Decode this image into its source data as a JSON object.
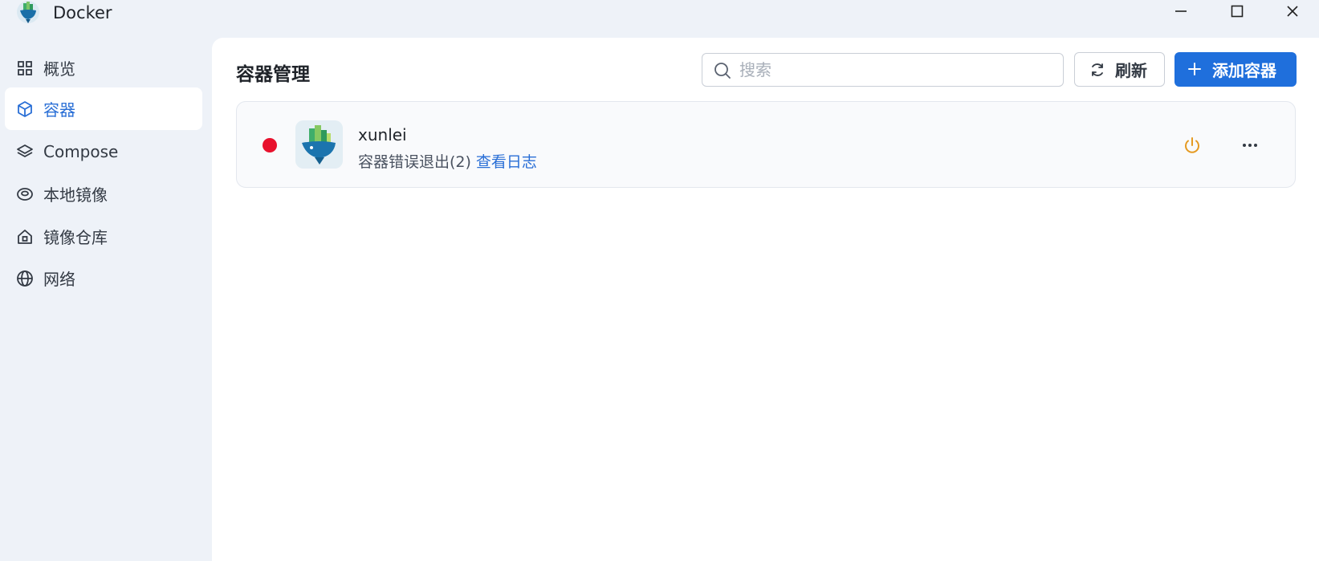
{
  "window": {
    "title": "Docker",
    "icons": [
      "docker-whale-logo",
      "minimize-icon",
      "maximize-icon",
      "close-icon"
    ]
  },
  "sidebar": {
    "items": [
      {
        "label": "概览",
        "icon": "grid-icon",
        "active": false
      },
      {
        "label": "容器",
        "icon": "cube-icon",
        "active": true
      },
      {
        "label": "Compose",
        "icon": "layers-icon",
        "active": false
      },
      {
        "label": "本地镜像",
        "icon": "eye-disc-icon",
        "active": false
      },
      {
        "label": "镜像仓库",
        "icon": "home-icon",
        "active": false
      },
      {
        "label": "网络",
        "icon": "globe-icon",
        "active": false
      }
    ],
    "active_color": "#2a6fd6"
  },
  "main": {
    "title": "容器管理",
    "search": {
      "placeholder": "搜索",
      "value": ""
    },
    "refresh_label": "刷新",
    "add_label": "添加容器",
    "accent_color": "#1f6fdc"
  },
  "containers": [
    {
      "name": "xunlei",
      "status_text": "容器错误退出(2)",
      "logs_link": "查看日志",
      "status_color": "#e8112d",
      "power_color": "#e59a22"
    }
  ]
}
